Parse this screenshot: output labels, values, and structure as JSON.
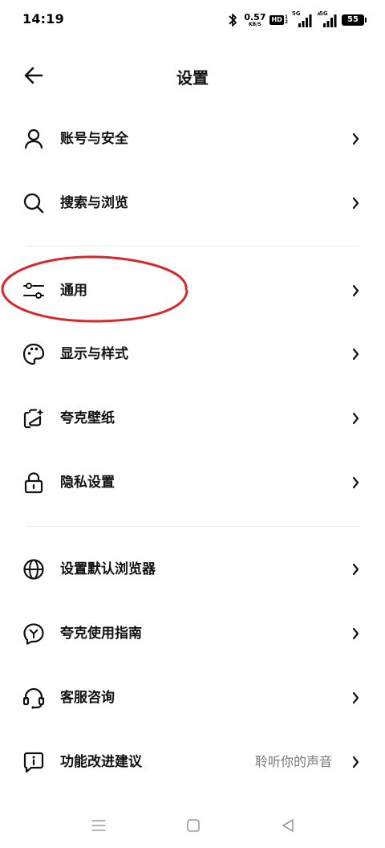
{
  "status_bar": {
    "time": "14:19",
    "speed_value": "0.57",
    "speed_unit": "KB/S",
    "hd_label": "HD",
    "hd_slot_1": "1",
    "hd_slot_2": "2",
    "signal_1_label": "5G",
    "signal_2_label": "5G",
    "battery_level": "55",
    "icons": [
      "bluetooth-icon",
      "hd-icon",
      "signal-icon",
      "signal-icon",
      "battery-icon"
    ]
  },
  "header": {
    "title": "设置",
    "back_icon": "arrow-left-icon"
  },
  "settings": {
    "items": [
      {
        "label": "账号与安全",
        "icon": "user-icon"
      },
      {
        "label": "搜索与浏览",
        "icon": "search-icon"
      },
      {
        "label": "通用",
        "icon": "sliders-icon"
      },
      {
        "label": "显示与样式",
        "icon": "palette-icon"
      },
      {
        "label": "夸克壁纸",
        "icon": "wallpaper-icon"
      },
      {
        "label": "隐私设置",
        "icon": "lock-icon"
      },
      {
        "label": "设置默认浏览器",
        "icon": "globe-icon"
      },
      {
        "label": "夸克使用指南",
        "icon": "guide-icon"
      },
      {
        "label": "客服咨询",
        "icon": "headset-icon"
      },
      {
        "label": "功能改进建议",
        "icon": "feedback-icon",
        "value": "聆听你的声音"
      }
    ]
  },
  "annotation": {
    "color": "#d9262b",
    "target": "通用"
  },
  "nav_bar": {
    "icons": [
      "menu-icon",
      "home-icon",
      "back-triangle-icon"
    ]
  }
}
